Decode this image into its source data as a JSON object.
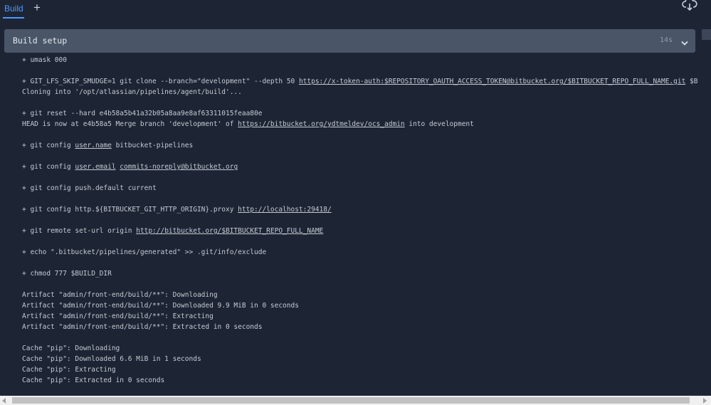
{
  "tabs": {
    "build_label": "Build",
    "add_label": "+"
  },
  "header": {
    "download_icon": "cloud-download-icon"
  },
  "step": {
    "title": "Build setup",
    "duration": "14s",
    "chevron_icon": "chevron-down-icon"
  },
  "log": {
    "lines": [
      [
        {
          "t": "+ umask 000"
        }
      ],
      [
        {
          "t": ""
        }
      ],
      [
        {
          "t": "+ GIT_LFS_SKIP_SMUDGE=1 git clone --branch=\"development\" --depth 50 "
        },
        {
          "t": "https://x-token-auth:$REPOSITORY_OAUTH_ACCESS_TOKEN@bitbucket.org/$BITBUCKET_REPO_FULL_NAME.git",
          "link": true
        },
        {
          "t": " $B"
        }
      ],
      [
        {
          "t": "Cloning into '/opt/atlassian/pipelines/agent/build'..."
        }
      ],
      [
        {
          "t": ""
        }
      ],
      [
        {
          "t": "+ git reset --hard e4b58a5b41a32b05a8aa9e8af63311015feaa80e"
        }
      ],
      [
        {
          "t": "HEAD is now at e4b58a5 Merge branch 'development' of "
        },
        {
          "t": "https://bitbucket.org/ydtmeldev/ocs_admin",
          "link": true
        },
        {
          "t": " into development"
        }
      ],
      [
        {
          "t": ""
        }
      ],
      [
        {
          "t": "+ git config "
        },
        {
          "t": "user.name",
          "link": true
        },
        {
          "t": " bitbucket-pipelines"
        }
      ],
      [
        {
          "t": ""
        }
      ],
      [
        {
          "t": "+ git config "
        },
        {
          "t": "user.email",
          "link": true
        },
        {
          "t": " "
        },
        {
          "t": "commits-noreply@bitbucket.org",
          "link": true
        }
      ],
      [
        {
          "t": ""
        }
      ],
      [
        {
          "t": "+ git config push.default current"
        }
      ],
      [
        {
          "t": ""
        }
      ],
      [
        {
          "t": "+ git config http.${BITBUCKET_GIT_HTTP_ORIGIN}.proxy "
        },
        {
          "t": "http://localhost:29418/",
          "link": true
        }
      ],
      [
        {
          "t": ""
        }
      ],
      [
        {
          "t": "+ git remote set-url origin "
        },
        {
          "t": "http://bitbucket.org/$BITBUCKET_REPO_FULL_NAME",
          "link": true
        }
      ],
      [
        {
          "t": ""
        }
      ],
      [
        {
          "t": "+ echo \".bitbucket/pipelines/generated\" >> .git/info/exclude"
        }
      ],
      [
        {
          "t": ""
        }
      ],
      [
        {
          "t": "+ chmod 777 $BUILD_DIR"
        }
      ],
      [
        {
          "t": ""
        }
      ],
      [
        {
          "t": "Artifact \"admin/front-end/build/**\": Downloading"
        }
      ],
      [
        {
          "t": "Artifact \"admin/front-end/build/**\": Downloaded 9.9 MiB in 0 seconds"
        }
      ],
      [
        {
          "t": "Artifact \"admin/front-end/build/**\": Extracting"
        }
      ],
      [
        {
          "t": "Artifact \"admin/front-end/build/**\": Extracted in 0 seconds"
        }
      ],
      [
        {
          "t": ""
        }
      ],
      [
        {
          "t": "Cache \"pip\": Downloading"
        }
      ],
      [
        {
          "t": "Cache \"pip\": Downloaded 6.6 MiB in 1 seconds"
        }
      ],
      [
        {
          "t": "Cache \"pip\": Extracting"
        }
      ],
      [
        {
          "t": "Cache \"pip\": Extracted in 0 seconds"
        }
      ]
    ]
  },
  "colors": {
    "background": "#1d2535",
    "accent": "#4c9aff",
    "step_header": "#4a5668",
    "log_text": "#c4cad3"
  }
}
